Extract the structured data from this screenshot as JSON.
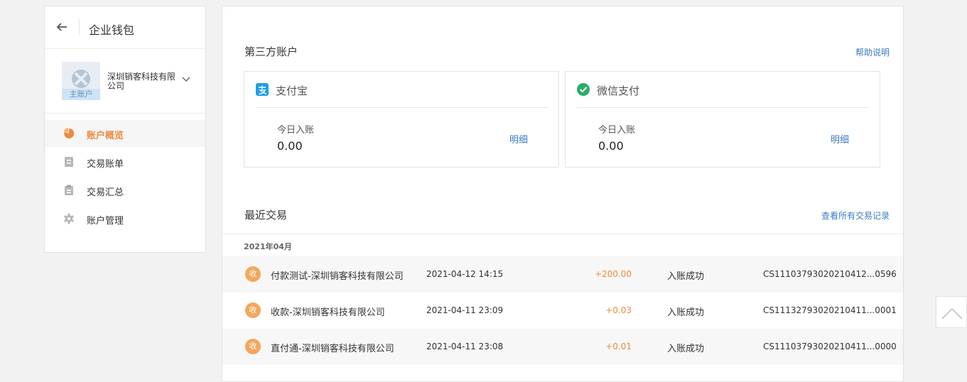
{
  "sidebar": {
    "title": "企业钱包",
    "company": {
      "name": "深圳销客科技有限公司",
      "badge": "主账户"
    },
    "nav": [
      {
        "label": "账户概览",
        "icon": "pie-chart-icon",
        "active": true
      },
      {
        "label": "交易账单",
        "icon": "document-icon",
        "active": false
      },
      {
        "label": "交易汇总",
        "icon": "clipboard-icon",
        "active": false
      },
      {
        "label": "账户管理",
        "icon": "gear-icon",
        "active": false
      }
    ]
  },
  "third_party": {
    "title": "第三方账户",
    "help_link": "帮助说明",
    "accounts": [
      {
        "name": "支付宝",
        "icon": "alipay-icon",
        "sub_label": "今日入账",
        "amount": "0.00",
        "detail": "明细"
      },
      {
        "name": "微信支付",
        "icon": "wechat-pay-icon",
        "sub_label": "今日入账",
        "amount": "0.00",
        "detail": "明细"
      }
    ]
  },
  "recent": {
    "title": "最近交易",
    "view_all": "查看所有交易记录",
    "month": "2021年04月",
    "transactions": [
      {
        "badge": "收",
        "title": "付款测试-深圳销客科技有限公司",
        "time": "2021-04-12 14:15",
        "amount": "+200.00",
        "status": "入账成功",
        "order": "CS11103793020210412...0596"
      },
      {
        "badge": "收",
        "title": "收款-深圳销客科技有限公司",
        "time": "2021-04-11 23:09",
        "amount": "+0.03",
        "status": "入账成功",
        "order": "CS11132793020210411...0001"
      },
      {
        "badge": "收",
        "title": "直付通-深圳销客科技有限公司",
        "time": "2021-04-11 23:08",
        "amount": "+0.01",
        "status": "入账成功",
        "order": "CS11103793020210411...0000"
      }
    ]
  },
  "colors": {
    "accent": "#f08a3c",
    "link": "#3b7ac5",
    "alipay": "#1c9fe8",
    "wechat": "#2aae67"
  }
}
